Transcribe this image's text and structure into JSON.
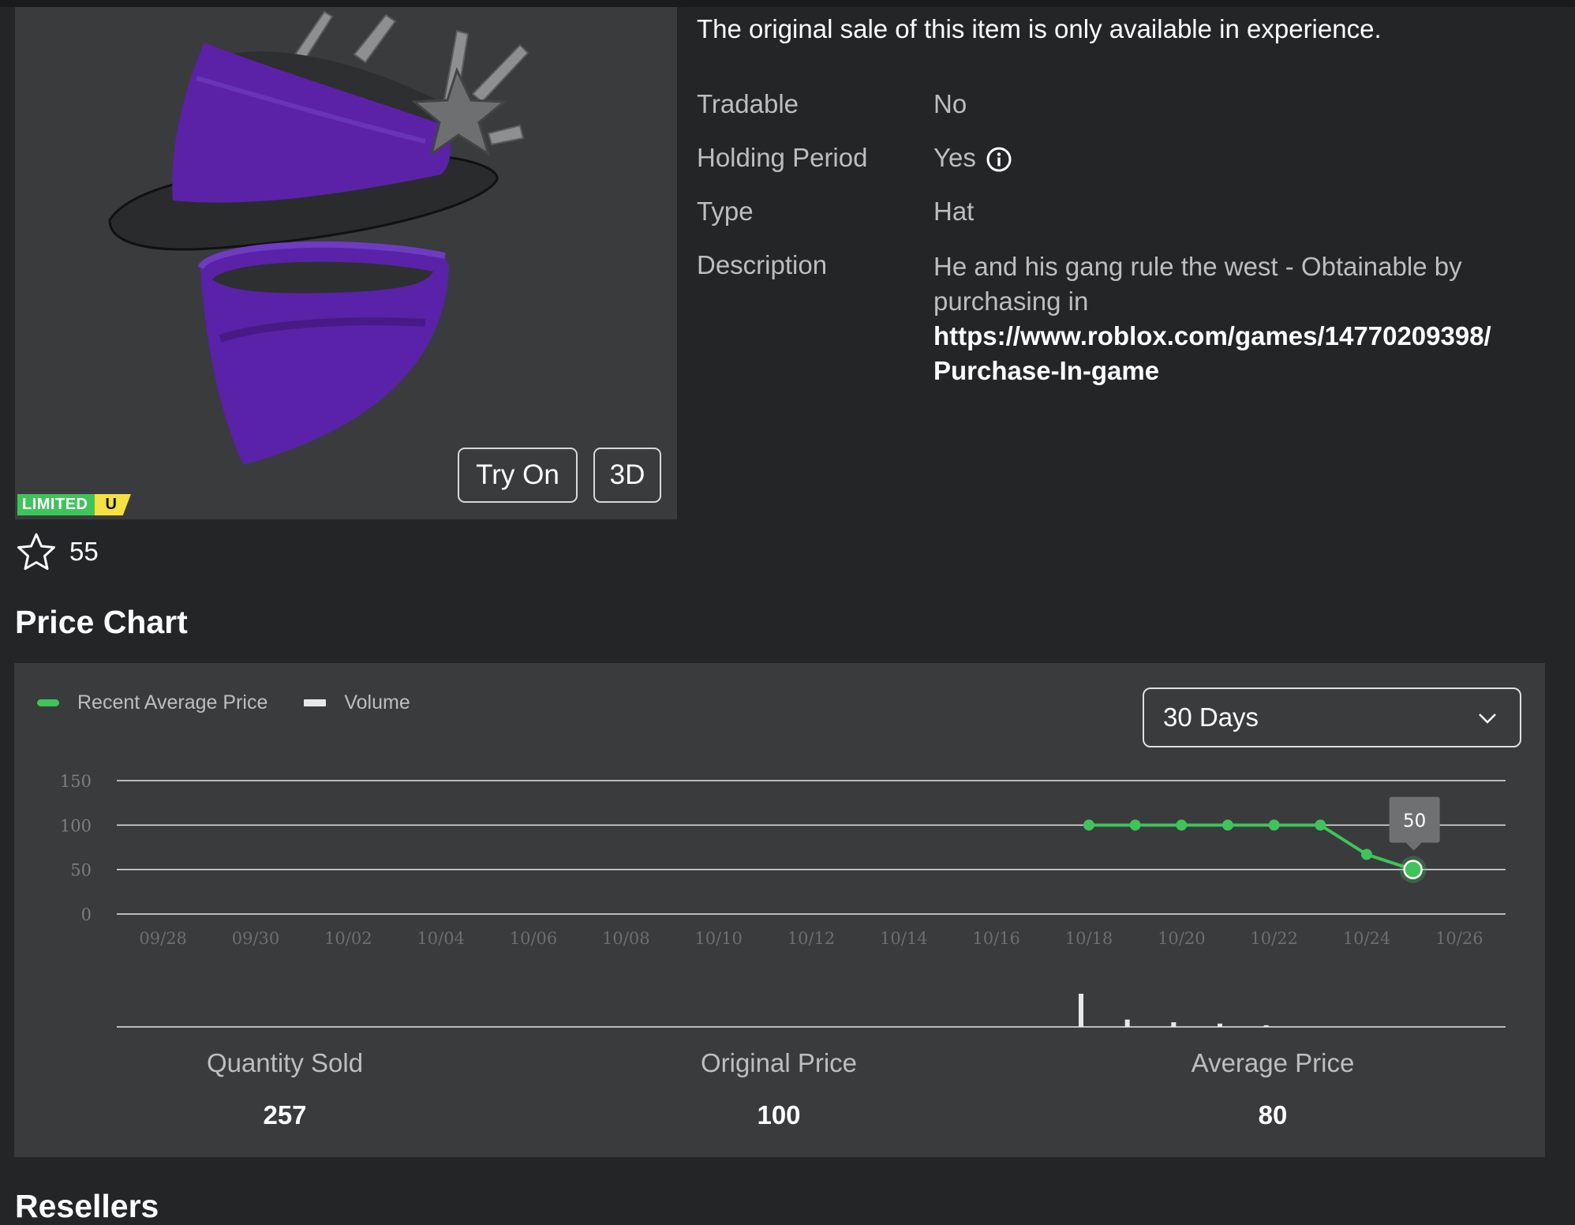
{
  "item": {
    "try_on_label": "Try On",
    "view_3d_label": "3D",
    "badge_limited": "LIMITED",
    "badge_unique": "U",
    "favorites": "55"
  },
  "details": {
    "sale_note": "The original sale of this item is only available in experience.",
    "rows": [
      {
        "label": "Tradable",
        "value": "No"
      },
      {
        "label": "Holding Period",
        "value": "Yes"
      },
      {
        "label": "Type",
        "value": "Hat"
      },
      {
        "label": "Description",
        "value": "He and his gang rule the west - Obtainable by purchasing in"
      }
    ],
    "description_link_line1": "https://www.roblox.com/games/14770209398/",
    "description_link_line2": "Purchase-In-game"
  },
  "price_chart_title": "Price Chart",
  "resellers_title": "Resellers",
  "legend": {
    "price": "Recent Average Price",
    "volume": "Volume"
  },
  "range_select": {
    "selected": "30 Days"
  },
  "colors": {
    "price_line": "#3ec459",
    "volume_bar": "#e8e8e8",
    "panel": "#393b3d",
    "background": "#232527"
  },
  "chart_data": {
    "type": "line",
    "x_ticks": [
      "09/28",
      "09/30",
      "10/02",
      "10/04",
      "10/06",
      "10/08",
      "10/10",
      "10/12",
      "10/14",
      "10/16",
      "10/18",
      "10/20",
      "10/22",
      "10/24",
      "10/26"
    ],
    "y_ticks": [
      0,
      50,
      100,
      150
    ],
    "ylim": [
      0,
      150
    ],
    "x_range": [
      "09/27",
      "10/27"
    ],
    "series": [
      {
        "name": "Recent Average Price",
        "x": [
          "10/18",
          "10/19",
          "10/20",
          "10/21",
          "10/22",
          "10/23",
          "10/24",
          "10/25"
        ],
        "y": [
          100,
          100,
          100,
          100,
          100,
          100,
          67,
          50
        ]
      }
    ],
    "volume": {
      "name": "Volume",
      "x": [
        "10/18",
        "10/19",
        "10/20",
        "10/21",
        "10/22"
      ],
      "relative": [
        1.0,
        0.22,
        0.14,
        0.1,
        0.05
      ]
    },
    "tooltip": {
      "x": "10/25",
      "value": "50"
    },
    "grid": true
  },
  "stats": [
    {
      "label": "Quantity Sold",
      "value": "257"
    },
    {
      "label": "Original Price",
      "value": "100"
    },
    {
      "label": "Average Price",
      "value": "80"
    }
  ]
}
